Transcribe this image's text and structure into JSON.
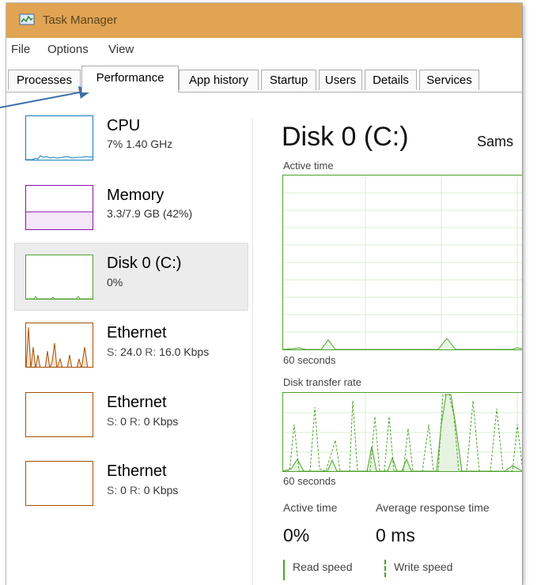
{
  "window": {
    "title": "Task Manager"
  },
  "menu": [
    "File",
    "Options",
    "View"
  ],
  "tabs": [
    "Processes",
    "Performance",
    "App history",
    "Startup",
    "Users",
    "Details",
    "Services"
  ],
  "active_tab": "Performance",
  "sidebar": [
    {
      "name": "CPU",
      "sub": "7% 1.40 GHz",
      "color": "#117dbb"
    },
    {
      "name": "Memory",
      "sub": "3.3/7.9 GB (42%)",
      "color": "#8b12ae"
    },
    {
      "name": "Disk 0 (C:)",
      "sub": "0%",
      "color": "#4da32a",
      "selected": true
    },
    {
      "name": "Ethernet",
      "sub_s_label": "S:",
      "sub_s_value": "24.0",
      "sub_r_label": "R:",
      "sub_r_value": "16.0 Kbps",
      "color": "#a74f01"
    },
    {
      "name": "Ethernet",
      "sub_s_label": "S:",
      "sub_s_value": "0",
      "sub_r_label": "R:",
      "sub_r_value": "0 Kbps",
      "color": "#a74f01"
    },
    {
      "name": "Ethernet",
      "sub_s_label": "S:",
      "sub_s_value": "0",
      "sub_r_label": "R:",
      "sub_r_value": "0 Kbps",
      "color": "#a74f01"
    }
  ],
  "main": {
    "title": "Disk 0 (C:)",
    "model": "Sams",
    "active_time_label": "Active time",
    "transfer_label": "Disk transfer rate",
    "seconds_label_1": "60 seconds",
    "seconds_label_2": "60 seconds",
    "stats": {
      "active_time_label": "Active time",
      "active_time_value": "0%",
      "response_label": "Average response time",
      "response_value": "0 ms"
    },
    "legend": {
      "read": "Read speed",
      "write": "Write speed"
    }
  },
  "colors": {
    "titlebar": "#e0a453",
    "disk": "#4da32a",
    "cpu": "#117dbb",
    "memory": "#8b12ae",
    "ethernet": "#a74f01",
    "annotation_arrow": "#3f6fa6"
  }
}
